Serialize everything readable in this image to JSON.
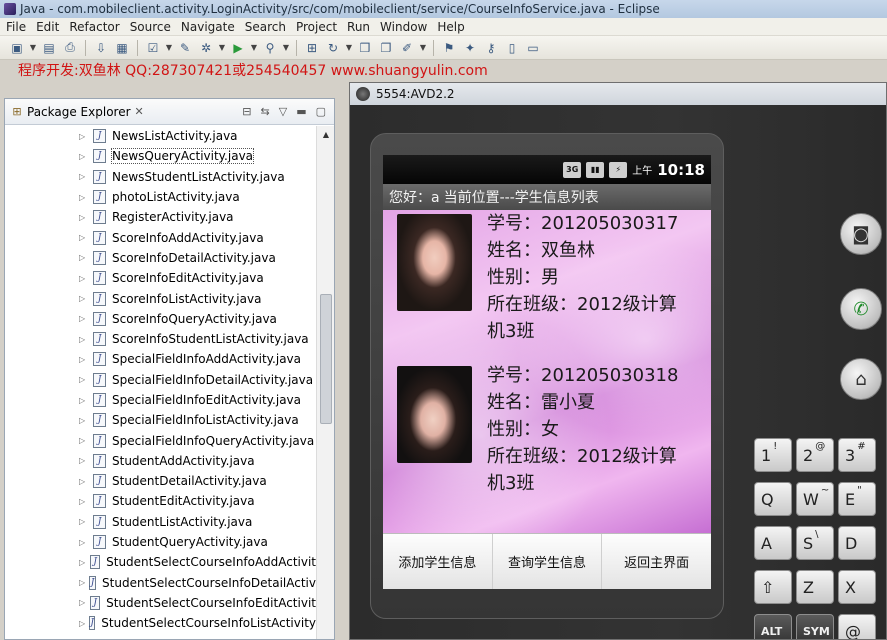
{
  "window": {
    "title": "Java - com.mobileclient.activity.LoginActivity/src/com/mobileclient/service/CourseInfoService.java - Eclipse"
  },
  "menu": [
    "File",
    "Edit",
    "Refactor",
    "Source",
    "Navigate",
    "Search",
    "Project",
    "Run",
    "Window",
    "Help"
  ],
  "toolbar": {
    "icons": [
      "new-icon",
      "save-icon",
      "print-icon",
      "debug-icon",
      "run-icon",
      "external-tools-icon",
      "open-type-icon",
      "search-icon",
      "next-annotation-icon",
      "prev-annotation-icon",
      "back-icon",
      "forward-icon"
    ]
  },
  "dev_info": "程序开发:双鱼林 QQ:287307421或254540457 www.shuangyulin.com",
  "package_explorer": {
    "title": "Package Explorer",
    "files": [
      "NewsListActivity.java",
      "NewsQueryActivity.java",
      "NewsStudentListActivity.java",
      "photoListActivity.java",
      "RegisterActivity.java",
      "ScoreInfoAddActivity.java",
      "ScoreInfoDetailActivity.java",
      "ScoreInfoEditActivity.java",
      "ScoreInfoListActivity.java",
      "ScoreInfoQueryActivity.java",
      "ScoreInfoStudentListActivity.java",
      "SpecialFieldInfoAddActivity.java",
      "SpecialFieldInfoDetailActivity.java",
      "SpecialFieldInfoEditActivity.java",
      "SpecialFieldInfoListActivity.java",
      "SpecialFieldInfoQueryActivity.java",
      "StudentAddActivity.java",
      "StudentDetailActivity.java",
      "StudentEditActivity.java",
      "StudentListActivity.java",
      "StudentQueryActivity.java",
      "StudentSelectCourseInfoAddActivit",
      "StudentSelectCourseInfoDetailActiv",
      "StudentSelectCourseInfoEditActivit",
      "StudentSelectCourseInfoListActivity"
    ],
    "selected_index": 1
  },
  "emulator": {
    "title": "5554:AVD2.2",
    "status_bar": {
      "icons": [
        "3G",
        "signal",
        "battery"
      ],
      "am_pm": "上午",
      "time": "10:18"
    },
    "app_title": {
      "greeting": "您好：a",
      "location": "当前位置---学生信息列表"
    },
    "students": [
      {
        "student_no": "学号：201205030317",
        "name": "姓名：双鱼林",
        "gender": "性别：男",
        "class_line1": "所在班级：2012级计算",
        "class_line2": "机3班"
      },
      {
        "student_no": "学号：201205030318",
        "name": "姓名：雷小夏",
        "gender": "性别：女",
        "class_line1": "所在班级：2012级计算",
        "class_line2": "机3班"
      }
    ],
    "bottom_buttons": [
      "添加学生信息",
      "查询学生信息",
      "返回主界面"
    ],
    "keyboard": {
      "rows": [
        [
          "1",
          "2",
          "3"
        ],
        [
          "Q",
          "W",
          "E"
        ],
        [
          "A",
          "S",
          "D"
        ],
        [
          "⇧",
          "Z",
          "X"
        ],
        [
          "ALT",
          "SYM",
          "@"
        ]
      ],
      "super": [
        [
          "!",
          "@",
          "#"
        ],
        [
          "",
          "~",
          "\""
        ],
        [
          "",
          "\\",
          ""
        ],
        [
          "",
          "",
          ""
        ],
        [
          "",
          "",
          ""
        ]
      ]
    }
  }
}
